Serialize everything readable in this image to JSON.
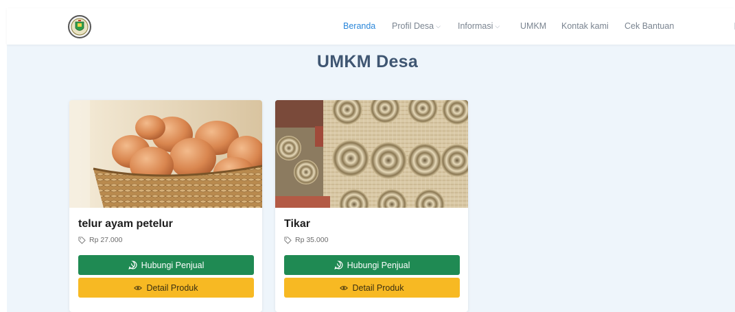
{
  "nav": {
    "items": [
      {
        "label": "Beranda",
        "active": true,
        "dropdown": false
      },
      {
        "label": "Profil Desa",
        "active": false,
        "dropdown": true
      },
      {
        "label": "Informasi",
        "active": false,
        "dropdown": true
      },
      {
        "label": "UMKM",
        "active": false,
        "dropdown": false
      },
      {
        "label": "Kontak kami",
        "active": false,
        "dropdown": false
      },
      {
        "label": "Cek Bantuan",
        "active": false,
        "dropdown": false
      }
    ],
    "chevron": "⌵"
  },
  "page": {
    "title": "UMKM Desa"
  },
  "products": [
    {
      "name": "telur ayam petelur",
      "price": "Rp 27.000",
      "contact_label": "Hubungi Penjual",
      "detail_label": "Detail Produk",
      "image": "egg-basket"
    },
    {
      "name": "Tikar",
      "price": "Rp 35.000",
      "contact_label": "Hubungi Penjual",
      "detail_label": "Detail Produk",
      "image": "rolled-mats"
    }
  ],
  "colors": {
    "accent": "#2a86d9",
    "whatsapp_button": "#1f8a53",
    "detail_button": "#f7b923",
    "page_background": "#eef5fb"
  },
  "icons": {
    "logo": "village-emblem",
    "price": "tag-icon",
    "contact": "whatsapp-icon",
    "detail": "eye-icon"
  }
}
